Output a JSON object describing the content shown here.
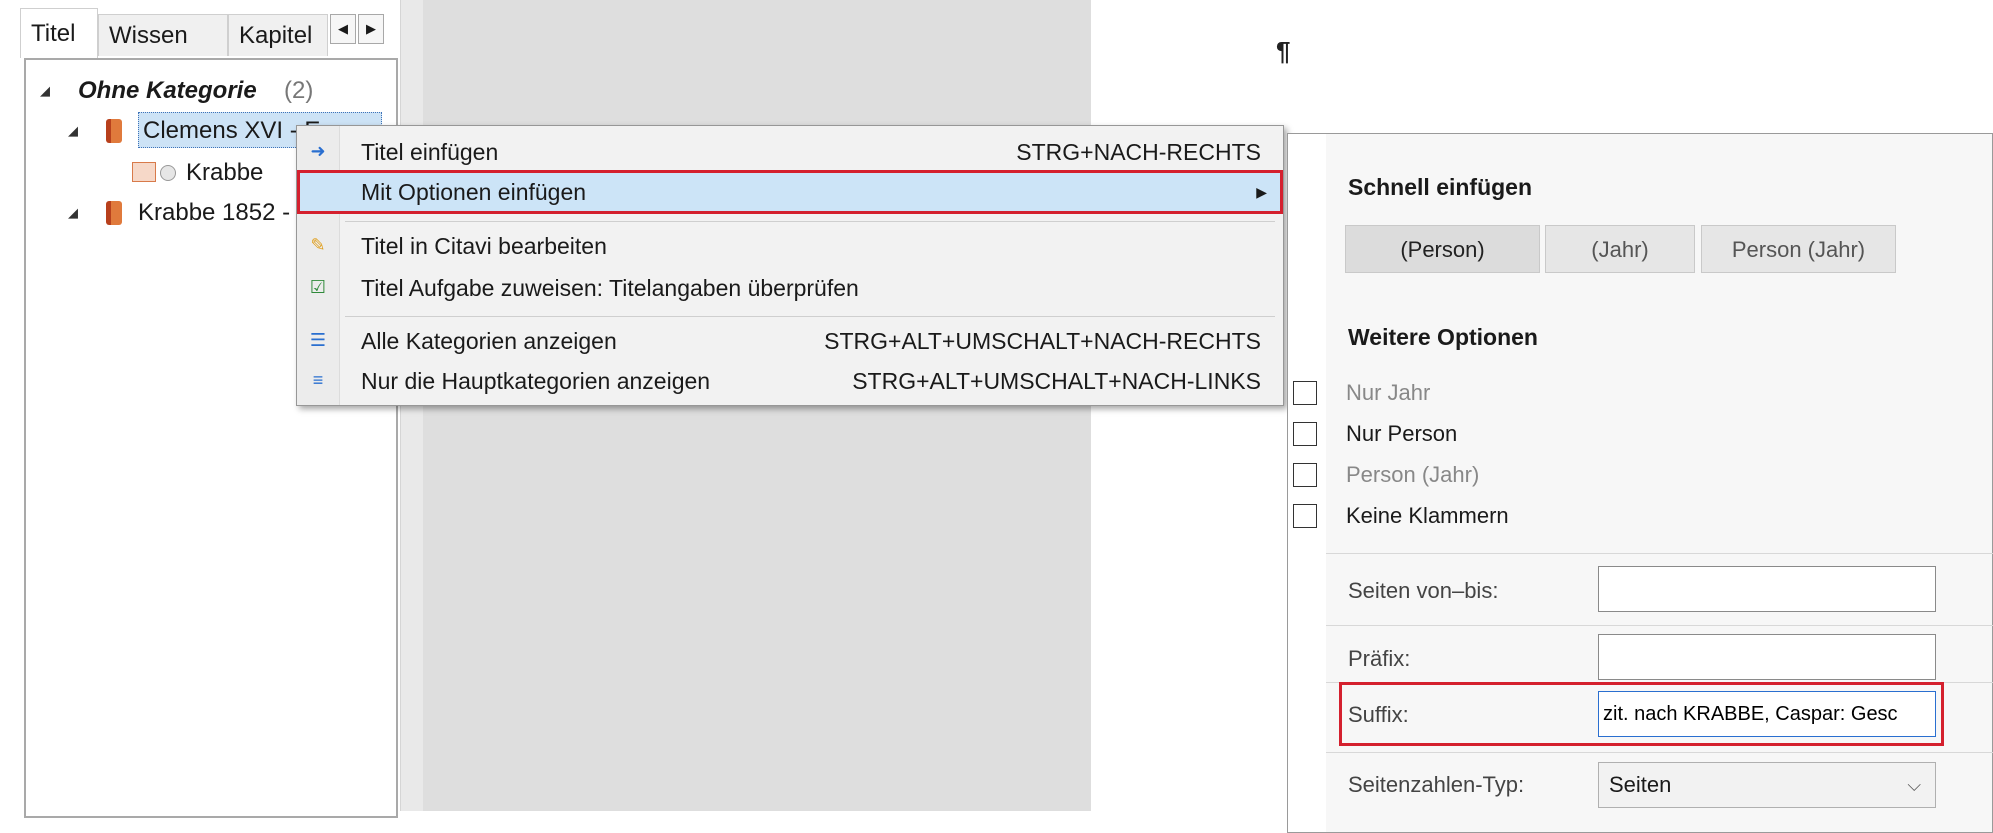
{
  "tabs": [
    "Titel",
    "Wissen",
    "Kapitel"
  ],
  "tree": {
    "category_label": "Ohne Kategorie",
    "category_count": "(2)",
    "item1": "Clemens XVI - E...",
    "item1_child": "Krabbe",
    "item2": "Krabbe 1852 -"
  },
  "doc": {
    "pilcrow": "¶"
  },
  "menu": {
    "items": [
      {
        "label": "Titel einfügen",
        "shortcut": "STRG+NACH-RECHTS"
      },
      {
        "label": "Mit Optionen einfügen",
        "shortcut": ""
      },
      {
        "label": "Titel in Citavi bearbeiten",
        "shortcut": ""
      },
      {
        "label": "Titel Aufgabe zuweisen: Titelangaben überprüfen",
        "shortcut": ""
      },
      {
        "label": "Alle Kategorien anzeigen",
        "shortcut": "STRG+ALT+UMSCHALT+NACH-RECHTS"
      },
      {
        "label": "Nur die Hauptkategorien anzeigen",
        "shortcut": "STRG+ALT+UMSCHALT+NACH-LINKS"
      }
    ]
  },
  "options": {
    "quick_title": "Schnell einfügen",
    "quick_buttons": [
      "(Person)",
      "(Jahr)",
      "Person (Jahr)"
    ],
    "more_title": "Weitere Optionen",
    "checks": [
      {
        "label": "Nur Jahr",
        "enabled": false
      },
      {
        "label": "Nur Person",
        "enabled": true
      },
      {
        "label": "Person (Jahr)",
        "enabled": false
      },
      {
        "label": "Keine Klammern",
        "enabled": true
      }
    ],
    "pages_label": "Seiten von–bis:",
    "pages_value": "",
    "prefix_label": "Präfix:",
    "prefix_value": "",
    "suffix_label": "Suffix:",
    "suffix_value": "zit. nach KRABBE, Caspar: Gesc",
    "pagetype_label": "Seitenzahlen-Typ:",
    "pagetype_value": "Seiten"
  },
  "colors": {
    "highlight": "#cce4f7",
    "red_outline": "#d4202e"
  }
}
